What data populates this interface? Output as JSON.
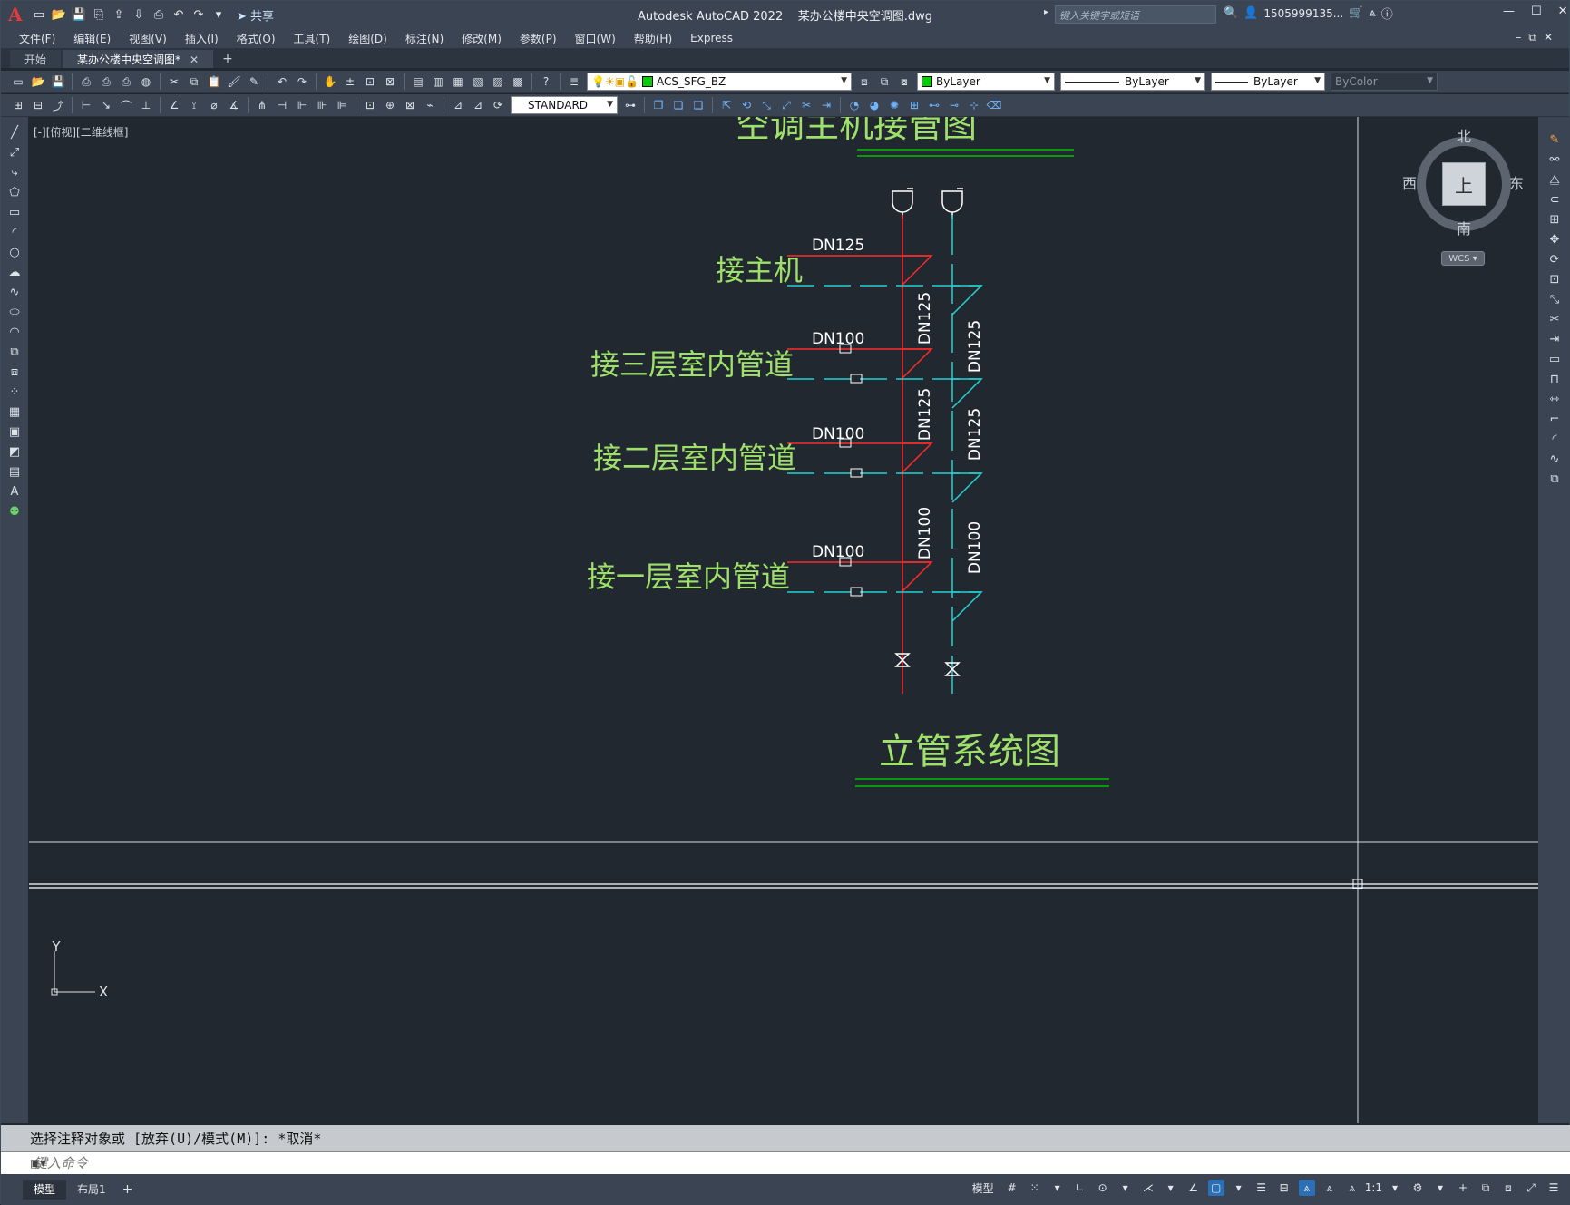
{
  "window": {
    "app_title": "Autodesk AutoCAD 2022",
    "file_title": "某办公楼中央空调图.dwg",
    "share_label": "共享",
    "search_placeholder": "键入关键字或短语",
    "user": "1505999135...",
    "minimize": "—",
    "maximize": "☐",
    "close": "✕"
  },
  "menu": [
    "文件(F)",
    "编辑(E)",
    "视图(V)",
    "插入(I)",
    "格式(O)",
    "工具(T)",
    "绘图(D)",
    "标注(N)",
    "修改(M)",
    "参数(P)",
    "窗口(W)",
    "帮助(H)",
    "Express"
  ],
  "tabs": {
    "start": "开始",
    "doc": "某办公楼中央空调图*",
    "close": "✕",
    "add": "+"
  },
  "layer_toolbar": {
    "layer": "ACS_SFG_BZ",
    "color": "ByLayer",
    "linetype": "ByLayer",
    "lineweight": "ByLayer",
    "plotstyle": "ByColor",
    "layer_color": "#00d000"
  },
  "style_toolbar": {
    "text_style": "STANDARD"
  },
  "viewport": {
    "label": "[-][俯视][二维线框]"
  },
  "viewcube": {
    "north": "北",
    "south": "南",
    "east": "东",
    "west": "西",
    "face": "上",
    "wcs": "WCS"
  },
  "drawing": {
    "top_title": "空调主机接管图",
    "bottom_title": "立管系统图",
    "connect_main": "接主机",
    "connect_3f": "接三层室内管道",
    "connect_2f": "接二层室内管道",
    "connect_1f": "接一层室内管道",
    "dn125_top": "DN125",
    "dn100_3": "DN100",
    "dn100_2": "DN100",
    "dn100_1": "DN100",
    "red_riser_upper": "DN125",
    "red_riser_mid": "DN125",
    "red_riser_lower": "DN100",
    "cyan_riser_upper": "DN125",
    "cyan_riser_mid": "DN125",
    "cyan_riser_lower": "DN100",
    "supply_color": "#ff2a2a",
    "return_color": "#22d3d3",
    "text_color": "#9ee06a",
    "title_line_color": "#00c000"
  },
  "ucs": {
    "x": "X",
    "y": "Y"
  },
  "command": {
    "history": "选择注释对象或 [放弃(U)/模式(M)]: *取消*",
    "placeholder": "键入命令"
  },
  "status": {
    "layout_model": "模型",
    "layout_1": "布局1",
    "add": "+",
    "model_space": "模型",
    "scale": "1:1"
  }
}
